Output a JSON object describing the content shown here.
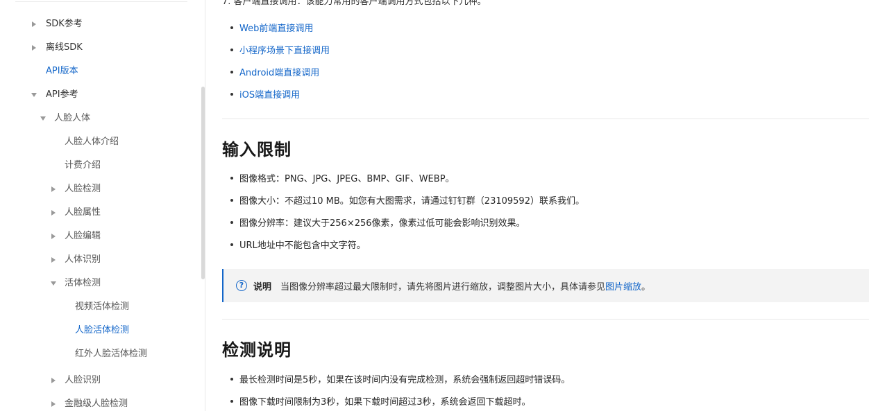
{
  "sidebar": {
    "items": [
      {
        "label": "SDK参考"
      },
      {
        "label": "离线SDK"
      },
      {
        "label": "API版本"
      },
      {
        "label": "API参考"
      },
      {
        "label": "人脸人体"
      },
      {
        "label": "人脸人体介绍"
      },
      {
        "label": "计费介绍"
      },
      {
        "label": "人脸检测"
      },
      {
        "label": "人脸属性"
      },
      {
        "label": "人脸编辑"
      },
      {
        "label": "人体识别"
      },
      {
        "label": "活体检测"
      },
      {
        "label": "视频活体检测"
      },
      {
        "label": "人脸活体检测"
      },
      {
        "label": "红外人脸活体检测"
      },
      {
        "label": "人脸识别"
      },
      {
        "label": "金融级人脸检测"
      }
    ]
  },
  "main": {
    "cut_line": "7. 客户端直接调用：该能力常用的客户端调用方式包括以下几种。",
    "call_links": [
      "Web前端直接调用",
      "小程序场景下直接调用",
      "Android端直接调用",
      "iOS端直接调用"
    ],
    "section1": {
      "title": "输入限制",
      "bullets": [
        "图像格式：PNG、JPG、JPEG、BMP、GIF、WEBP。",
        "图像大小：不超过10 MB。如您有大图需求，请通过钉钉群（23109592）联系我们。",
        "图像分辨率：建议大于256×256像素，像素过低可能会影响识别效果。",
        "URL地址中不能包含中文字符。"
      ]
    },
    "note": {
      "icon": "?",
      "label": "说明",
      "text": "当图像分辨率超过最大限制时，请先将图片进行缩放，调整图片大小，具体请参见",
      "link": "图片缩放",
      "end": "。"
    },
    "section2": {
      "title": "检测说明",
      "bullets": [
        "最长检测时间是5秒，如果在该时间内没有完成检测，系统会强制返回超时错误码。",
        "图像下载时间限制为3秒，如果下载时间超过3秒，系统会返回下载超时。"
      ]
    }
  },
  "colors": {
    "link": "#1366c9",
    "text": "#262626",
    "note_bg": "#f3f3f3"
  }
}
